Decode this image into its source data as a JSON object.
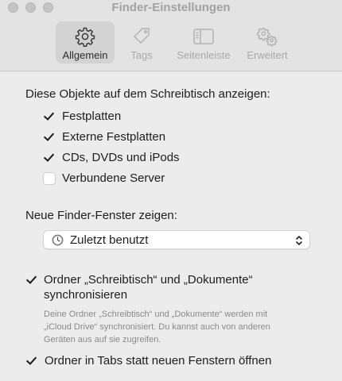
{
  "window": {
    "title": "Finder-Einstellungen"
  },
  "tabs": [
    {
      "label": "Allgemein",
      "icon": "gear-icon",
      "active": true
    },
    {
      "label": "Tags",
      "icon": "tag-icon",
      "active": false
    },
    {
      "label": "Seitenleiste",
      "icon": "sidebar-icon",
      "active": false
    },
    {
      "label": "Erweitert",
      "icon": "gears-icon",
      "active": false
    }
  ],
  "desktop_section": {
    "heading": "Diese Objekte auf dem Schreibtisch anzeigen:",
    "items": [
      {
        "label": "Festplatten",
        "checked": true
      },
      {
        "label": "Externe Festplatten",
        "checked": true
      },
      {
        "label": "CDs, DVDs und iPods",
        "checked": true
      },
      {
        "label": "Verbundene Server",
        "checked": false
      }
    ]
  },
  "new_window": {
    "heading": "Neue Finder-Fenster zeigen:",
    "selected": "Zuletzt benutzt",
    "icon": "clock-icon"
  },
  "icloud_sync": {
    "label": "Ordner „Schreibtisch“ und „Dokumente“ synchronisieren",
    "checked": true,
    "description": "Deine Ordner „Schreibtisch“ und „Dokumente“ werden mit „iCloud Drive“ synchronisiert. Du kannst auch von anderen Geräten aus auf sie zugreifen."
  },
  "tabs_option": {
    "label": "Ordner in Tabs statt neuen Fenstern öffnen",
    "checked": true
  }
}
